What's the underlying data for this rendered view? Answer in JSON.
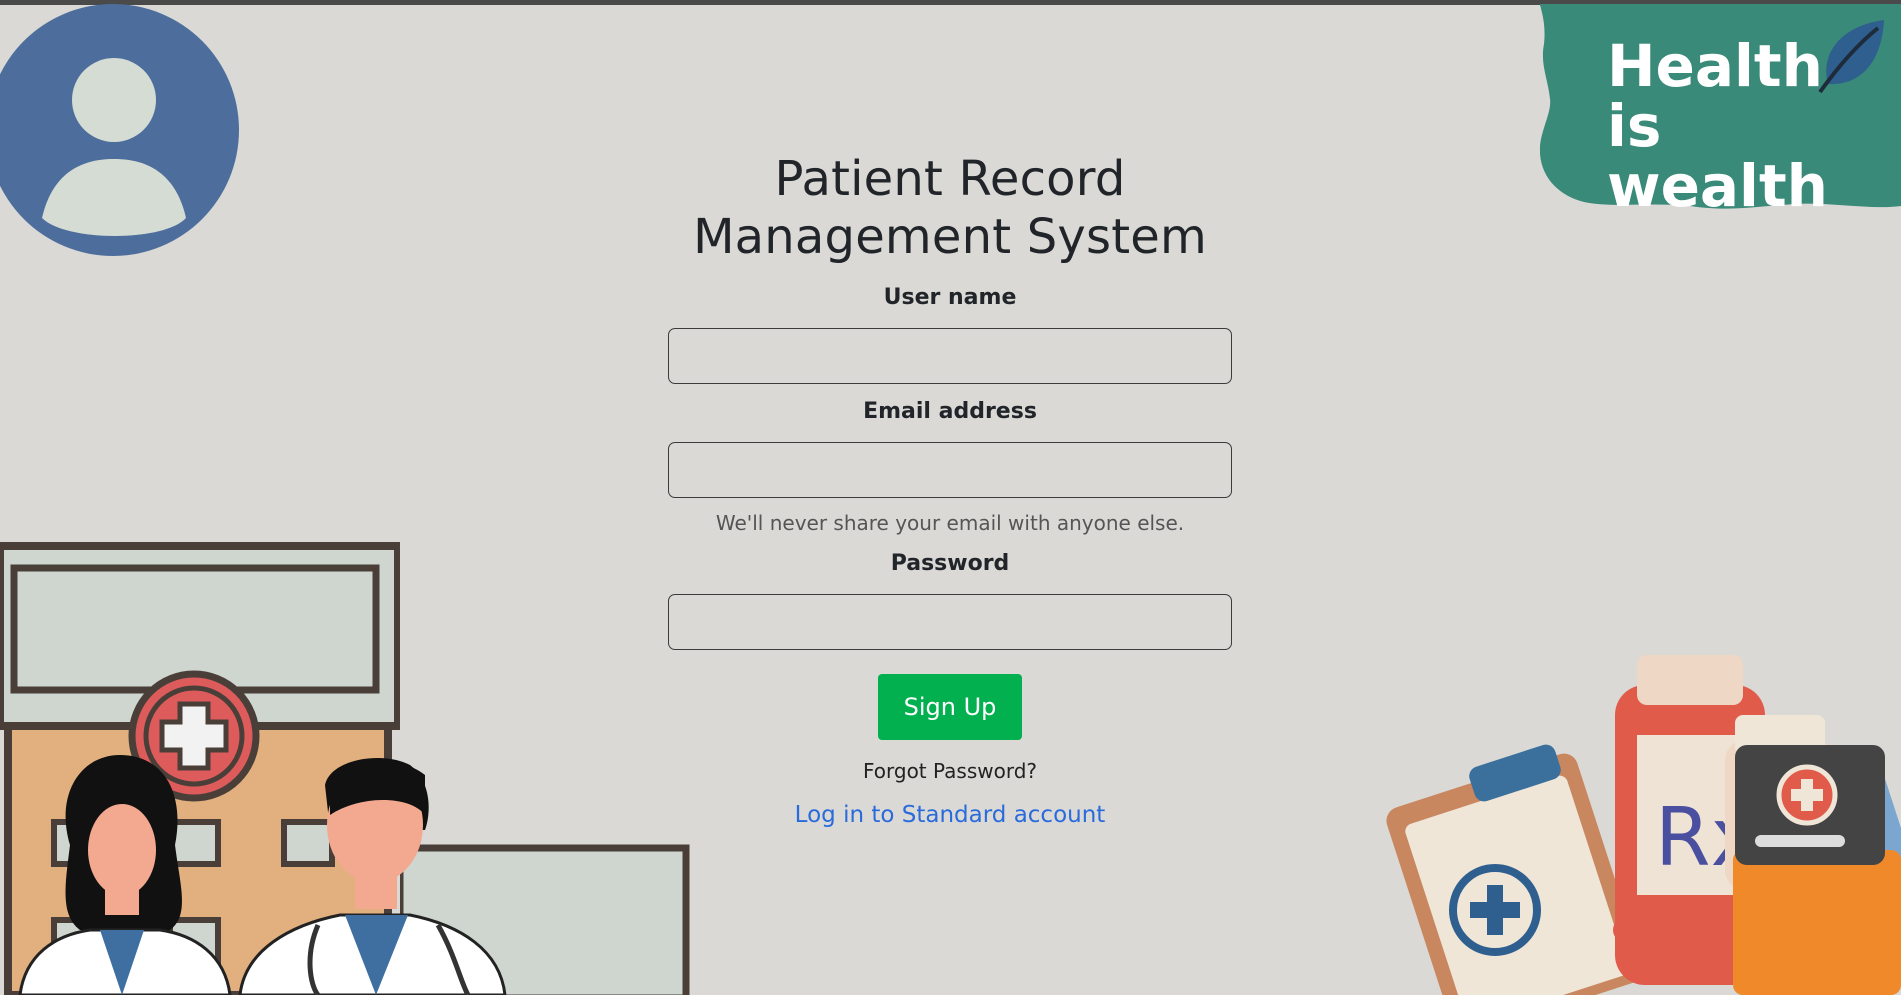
{
  "brand": {
    "title_line1": "Patient Record",
    "title_line2": "Management System",
    "badge_line1": "Health",
    "badge_line2": "is wealth",
    "badge_color": "#3a8a79",
    "avatar_color": "#4d6e9c"
  },
  "form": {
    "username_label": "User name",
    "username_value": "",
    "email_label": "Email address",
    "email_value": "",
    "email_help": "We'll never share your email with anyone else.",
    "password_label": "Password",
    "password_value": "",
    "submit_label": "Sign Up",
    "forgot_label": "Forgot Password?",
    "standard_login_label": "Log in to Standard account"
  },
  "colors": {
    "background": "#dad9d6",
    "submit": "#03b04f",
    "link": "#2a6bdc"
  },
  "icons": {
    "avatar": "user-avatar-icon",
    "leaf": "leaf-icon",
    "hospital": "hospital-building-illustration",
    "doctors": "doctors-illustration",
    "medicine": "medicine-illustration"
  }
}
